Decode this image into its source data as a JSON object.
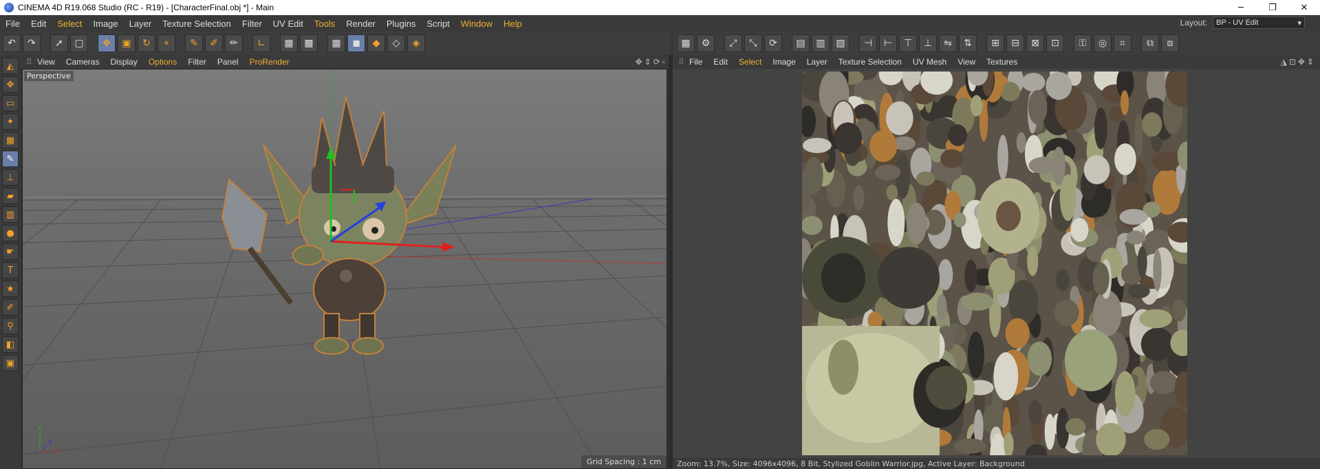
{
  "titlebar": {
    "title": "CINEMA 4D R19.068 Studio (RC - R19) - [CharacterFinal.obj *] - Main",
    "minimize": "─",
    "maximize": "❐",
    "close": "✕"
  },
  "menubar": {
    "items": [
      "File",
      "Edit",
      "Select",
      "Image",
      "Layer",
      "Texture Selection",
      "Filter",
      "UV Edit",
      "Tools",
      "Render",
      "Plugins",
      "Script",
      "Window",
      "Help"
    ],
    "layout_label": "Layout:",
    "layout_value": "BP - UV Edit"
  },
  "viewport": {
    "menu": [
      "View",
      "Cameras",
      "Display",
      "Options",
      "Filter",
      "Panel",
      "ProRender"
    ],
    "label": "Perspective",
    "grid_spacing": "Grid Spacing : 1 cm"
  },
  "uv_editor": {
    "menu": [
      "File",
      "Edit",
      "Select",
      "Image",
      "Layer",
      "Texture Selection",
      "UV Mesh",
      "View",
      "Textures"
    ],
    "status": "Zoom: 13.7%, Size: 4096x4096, 8 Bit, Stylized Goblin Warrior.jpg, Active Layer: Background"
  },
  "colors": {
    "accent": "#f0b030",
    "active_tool": "#6a7ea8",
    "panel": "#3a3a3a"
  }
}
